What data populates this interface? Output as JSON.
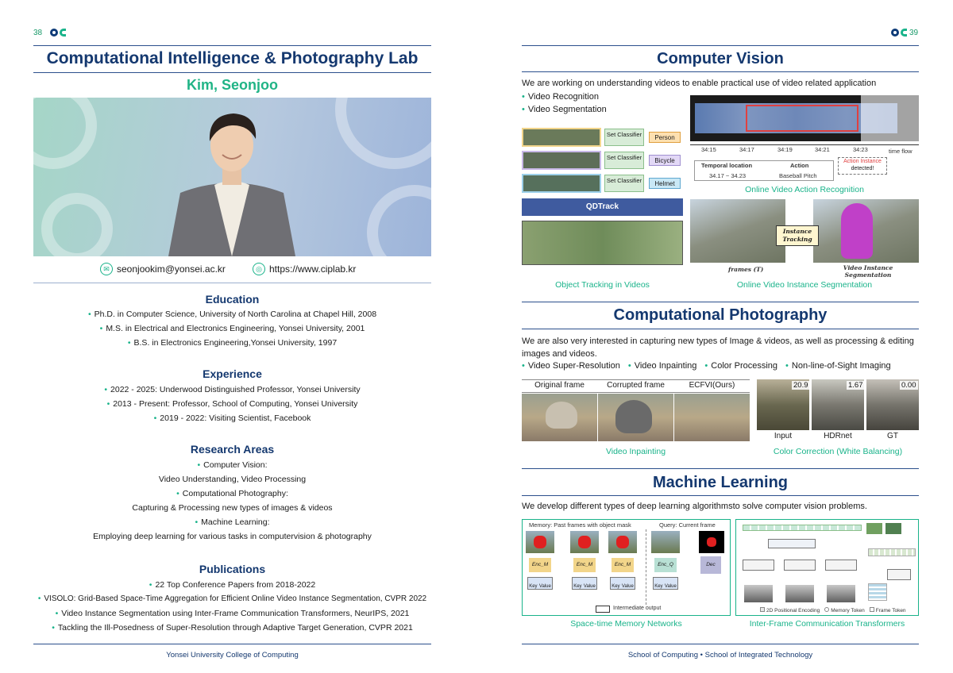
{
  "left": {
    "page_number": "38",
    "title": "Computational Intelligence & Photography Lab",
    "name": "Kim, Seonjoo",
    "email": "seonjookim@yonsei.ac.kr",
    "website": "https://www.ciplab.kr",
    "education": {
      "heading": "Education",
      "items": [
        "Ph.D. in Computer Science, University of North Carolina at Chapel Hill, 2008",
        "M.S. in Electrical and Electronics Engineering, Yonsei University, 2001",
        "B.S. in Electronics Engineering,Yonsei University, 1997"
      ]
    },
    "experience": {
      "heading": "Experience",
      "items": [
        "2022 - 2025: Underwood Distinguished Professor, Yonsei University",
        "2013 - Present: Professor, School of Computing, Yonsei University",
        "2019 - 2022: Visiting Scientist, Facebook"
      ]
    },
    "research": {
      "heading": "Research Areas",
      "lines": [
        "Computer Vision:",
        "Video Understanding, Video Processing",
        "Computational Photography:",
        "Capturing & Processing new types of images & videos",
        "Machine Learning:",
        "Employing deep learning for various tasks in computervision & photography"
      ]
    },
    "publications": {
      "heading": "Publications",
      "items": [
        "22 Top Conference Papers from 2018-2022",
        "VISOLO: Grid-Based Space-Time Aggregation for Efficient Online Video Instance Segmentation, CVPR 2022",
        "Video Instance Segmentation using Inter-Frame Communication Transformers, NeurIPS, 2021",
        "Tackling the Ill-Posedness of Super-Resolution through Adaptive Target Generation, CVPR 2021"
      ]
    },
    "footer": "Yonsei University College of Computing"
  },
  "right": {
    "page_number": "39",
    "cv": {
      "title": "Computer Vision",
      "intro": "We are working on understanding videos to enable practical use of video related application",
      "bullets": [
        "Video Recognition",
        "Video Segmentation"
      ],
      "fig1": {
        "classifier_label": "Set Classifier",
        "classes": [
          "Person",
          "Bicycle",
          "Helmet"
        ],
        "tracker": "QDTrack",
        "caption": "Object Tracking in Videos"
      },
      "fig2": {
        "times": [
          "34:15",
          "34:17",
          "34:19",
          "34:21",
          "34:23"
        ],
        "time_flow": "time flow",
        "col1": "Temporal location",
        "col2": "Action",
        "val1": "34.17 ~ 34.23",
        "val2": "Baseball Pitch",
        "instance_label": "Action Instance",
        "instance_detected": "detected!",
        "caption": "Online Video Action Recognition"
      },
      "fig3": {
        "box": "Instance Tracking",
        "frames": "frames (T)",
        "output": "Video Instance Segmentation",
        "caption": "Online Video Instance Segmentation"
      }
    },
    "cp": {
      "title": "Computational Photography",
      "intro": "We are also very interested in capturing new types of Image & videos, as well as processing & editing images and videos.",
      "bullets": [
        "Video Super-Resolution",
        "Video Inpainting",
        "Color Processing",
        "Non-line-of-Sight Imaging"
      ],
      "inpaint": {
        "labels": [
          "Original frame",
          "Corrupted frame",
          "ECFVI(Ours)"
        ],
        "caption": "Video Inpainting"
      },
      "color": {
        "scores": [
          "20.9",
          "1.67",
          "0.00"
        ],
        "labels": [
          "Input",
          "HDRnet",
          "GT"
        ],
        "caption": "Color Correction (White Balancing)"
      }
    },
    "ml": {
      "title": "Machine Learning",
      "intro": "We develop different types of deep learning algorithmsto solve computer vision problems.",
      "stm": {
        "memory_label": "Memory: Past frames with object mask",
        "query_label": "Query: Current frame",
        "enc_m": "Enc_M",
        "enc_q": "Enc_Q",
        "dec": "Dec",
        "key": "Key",
        "value": "Value",
        "intermediate": "Intermediate output",
        "caption": "Space-time Memory Networks"
      },
      "ifc": {
        "legend": [
          "2D Positional Encoding",
          "Memory Token",
          "Frame Token"
        ],
        "caption": "Inter-Frame Communication Transformers"
      }
    },
    "footer": "School of Computing • School of Integrated Technology"
  },
  "colors": {
    "navy": "#14386f",
    "green": "#19b38a"
  }
}
